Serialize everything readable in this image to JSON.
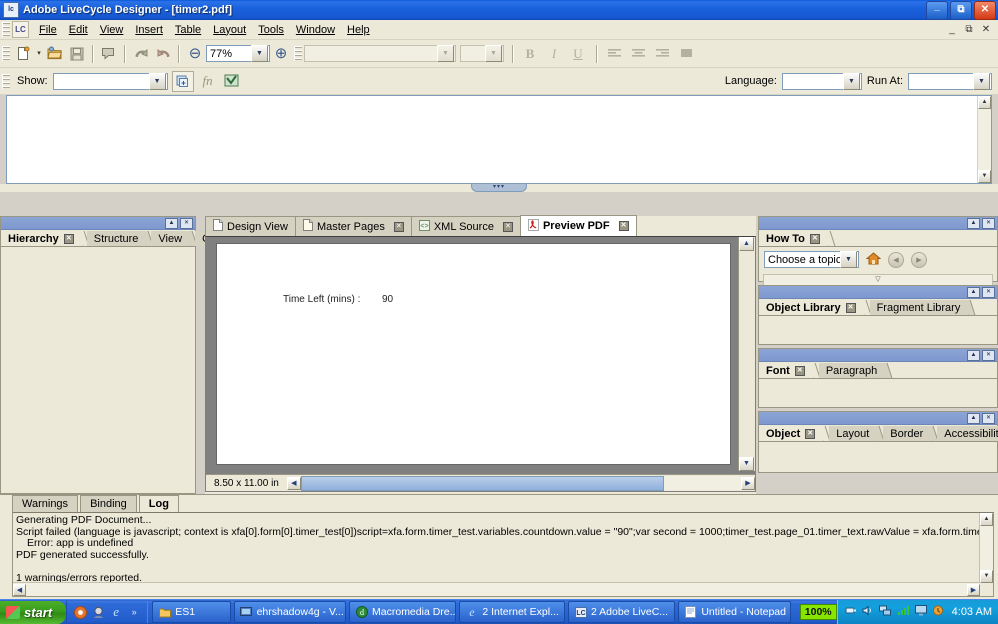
{
  "window": {
    "title": "Adobe LiveCycle Designer  - [timer2.pdf]",
    "app_icon": "lc",
    "minimize": "_",
    "maximize": "❐",
    "close": "✕"
  },
  "mdi": {
    "minimize": "_",
    "restore": "❐",
    "close": "✕"
  },
  "menu": {
    "icon": "lc-doc-icon",
    "items": [
      "File",
      "Edit",
      "View",
      "Insert",
      "Table",
      "Layout",
      "Tools",
      "Window",
      "Help"
    ]
  },
  "toolbar": {
    "new_label": "new-document",
    "new_dropdown": "▾",
    "open_label": "open",
    "save_label": "save",
    "preview_label": "form-preview",
    "undo_label": "undo",
    "redo_label": "redo",
    "zoom_out": "⊖",
    "zoom_value": "77%",
    "zoom_in": "⊕",
    "font_name": "",
    "font_size": "",
    "bold": "B",
    "italic": "I",
    "underline": "U",
    "align_left": "≡",
    "align_center": "≡",
    "align_right": "≡",
    "align_justify": "■"
  },
  "scriptbar": {
    "show_label": "Show:",
    "show_value": "",
    "expand_label": "expand-script-editor",
    "function_label": "fn",
    "checker_label": "script-validate",
    "language_label": "Language:",
    "language_value": "",
    "runat_label": "Run At:",
    "runat_value": ""
  },
  "left_dock": {
    "tabs": [
      {
        "label": "Hierarchy",
        "active": true,
        "closable": true
      },
      {
        "label": "Structure",
        "active": false,
        "closable": false
      },
      {
        "label": "View",
        "active": false,
        "closable": false
      },
      {
        "label": "Order",
        "active": false,
        "closable": false
      }
    ]
  },
  "document": {
    "tabs": [
      {
        "label": "Design View",
        "icon": "page-icon",
        "active": false,
        "closable": false
      },
      {
        "label": "Master Pages",
        "icon": "page-icon",
        "active": false,
        "closable": true
      },
      {
        "label": "XML Source",
        "icon": "xml-icon",
        "active": false,
        "closable": true
      },
      {
        "label": "Preview PDF",
        "icon": "pdf-icon",
        "active": true,
        "closable": true
      }
    ],
    "page": {
      "field_label": "Time Left (mins) :",
      "field_value": "90"
    },
    "status_size": "8.50 x 11.00 in"
  },
  "right_dock": {
    "howto": {
      "tabs": [
        {
          "label": "How To",
          "active": true,
          "closable": true
        }
      ],
      "topic_value": "Choose a topic...",
      "home_icon": "home-icon",
      "back_icon": "back-icon",
      "forward_icon": "forward-icon"
    },
    "library": {
      "tabs": [
        {
          "label": "Object Library",
          "active": true,
          "closable": true
        },
        {
          "label": "Fragment Library",
          "active": false,
          "closable": false
        }
      ]
    },
    "font": {
      "tabs": [
        {
          "label": "Font",
          "active": true,
          "closable": true
        },
        {
          "label": "Paragraph",
          "active": false,
          "closable": false
        }
      ]
    },
    "object": {
      "tabs": [
        {
          "label": "Object",
          "active": true,
          "closable": true
        },
        {
          "label": "Layout",
          "active": false,
          "closable": false
        },
        {
          "label": "Border",
          "active": false,
          "closable": false
        },
        {
          "label": "Accessibility",
          "active": false,
          "closable": false
        }
      ]
    }
  },
  "bottom_dock": {
    "tabs": [
      {
        "label": "Warnings",
        "active": false
      },
      {
        "label": "Binding",
        "active": false
      },
      {
        "label": "Log",
        "active": true
      }
    ],
    "log_lines": [
      {
        "text": "Generating PDF Document...",
        "indent": false
      },
      {
        "text": "Script failed (language is javascript; context is xfa[0].form[0].timer_test[0])script=xfa.form.timer_test.variables.countdown.value = \"90\";var second = 1000;timer_test.page_01.timer_text.rawValue = xfa.form.timer_test.variables.countdown.value;dumn",
        "indent": false
      },
      {
        "text": "Error: app is undefined",
        "indent": true
      },
      {
        "text": "PDF generated successfully.",
        "indent": false
      },
      {
        "text": "",
        "indent": false
      },
      {
        "text": "1 warnings/errors reported.",
        "indent": false
      }
    ]
  },
  "taskbar": {
    "start_label": "start",
    "quicklaunch": [
      "media-player-icon",
      "messenger-icon",
      "internet-explorer-icon",
      "chevron-more-icon"
    ],
    "tasks": [
      {
        "label": "ES1",
        "icon": "folder-icon",
        "dropdown": false
      },
      {
        "label": "ehrshadow4g - V...",
        "icon": "remote-desktop-icon",
        "dropdown": false
      },
      {
        "label": "Macromedia Dre...",
        "icon": "dreamweaver-icon",
        "dropdown": false
      },
      {
        "label": "2 Internet Expl...",
        "icon": "internet-explorer-icon",
        "dropdown": true
      },
      {
        "label": "2 Adobe LiveC...",
        "icon": "lc-icon",
        "dropdown": true
      },
      {
        "label": "Untitled - Notepad",
        "icon": "notepad-icon",
        "dropdown": false
      }
    ],
    "battery_badge": "100%",
    "tray_icons": [
      "power-icon",
      "volume-icon",
      "network-icon",
      "signal-icon",
      "display-icon",
      "update-icon"
    ],
    "clock": "4:03 AM"
  },
  "colors": {
    "titlebar_blue": "#1a62dd",
    "face": "#ece9d8",
    "panel_border": "#9a9684",
    "taskbar_blue": "#225ccb",
    "start_green": "#399c1c",
    "battery_green": "#86e600"
  }
}
